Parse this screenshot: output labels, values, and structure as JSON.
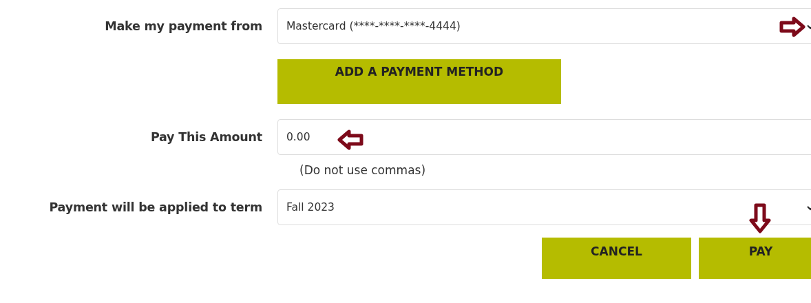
{
  "rows": [
    {
      "label": "Make my payment from",
      "kind": "select",
      "value": "Mastercard (****-****-****-4444)"
    },
    {
      "label": "Pay This Amount",
      "kind": "input",
      "value": "0.00",
      "hint": "(Do not use commas)"
    },
    {
      "label": "Payment will be applied to term",
      "kind": "select",
      "value": "Fall 2023"
    }
  ],
  "add_button": "ADD A PAYMENT METHOD",
  "buttons": [
    "CANCEL",
    "PAY"
  ]
}
